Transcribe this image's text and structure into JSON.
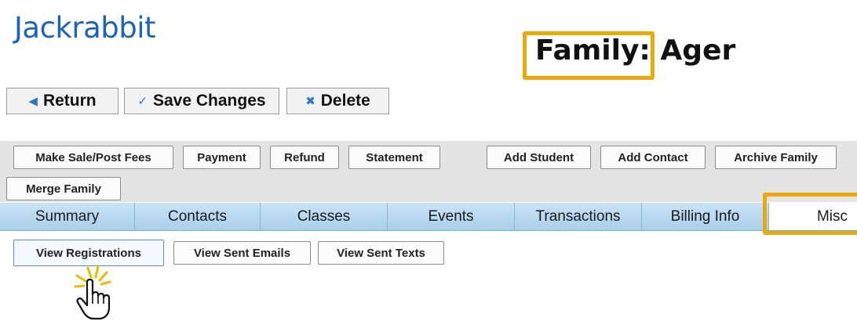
{
  "app": {
    "logo_text": "Jackrabbit"
  },
  "header": {
    "family_label": "Family:",
    "family_name": "Ager"
  },
  "top_buttons": {
    "return_label": "Return",
    "return_icon": "triangle-left-icon",
    "save_label": "Save Changes",
    "save_icon": "checkmark-icon",
    "delete_label": "Delete",
    "delete_icon": "x-icon"
  },
  "actions": {
    "make_sale": "Make Sale/Post Fees",
    "payment": "Payment",
    "refund": "Refund",
    "statement": "Statement",
    "add_student": "Add Student",
    "add_contact": "Add Contact",
    "archive_family": "Archive Family",
    "merge_family": "Merge Family"
  },
  "tabs": [
    "Summary",
    "Contacts",
    "Classes",
    "Events",
    "Transactions",
    "Billing Info",
    "Misc"
  ],
  "active_tab": "Misc",
  "misc": {
    "view_registrations": "View Registrations",
    "view_sent_emails": "View Sent Emails",
    "view_sent_texts": "View Sent Texts"
  },
  "annotations": {
    "highlight_color": "#e8a90c",
    "cursor": "hand-pointer-click-icon"
  },
  "colors": {
    "brand": "#1b64b8",
    "tab_bar": "#b7d8ef",
    "toolbar": "#e4e4e4"
  }
}
